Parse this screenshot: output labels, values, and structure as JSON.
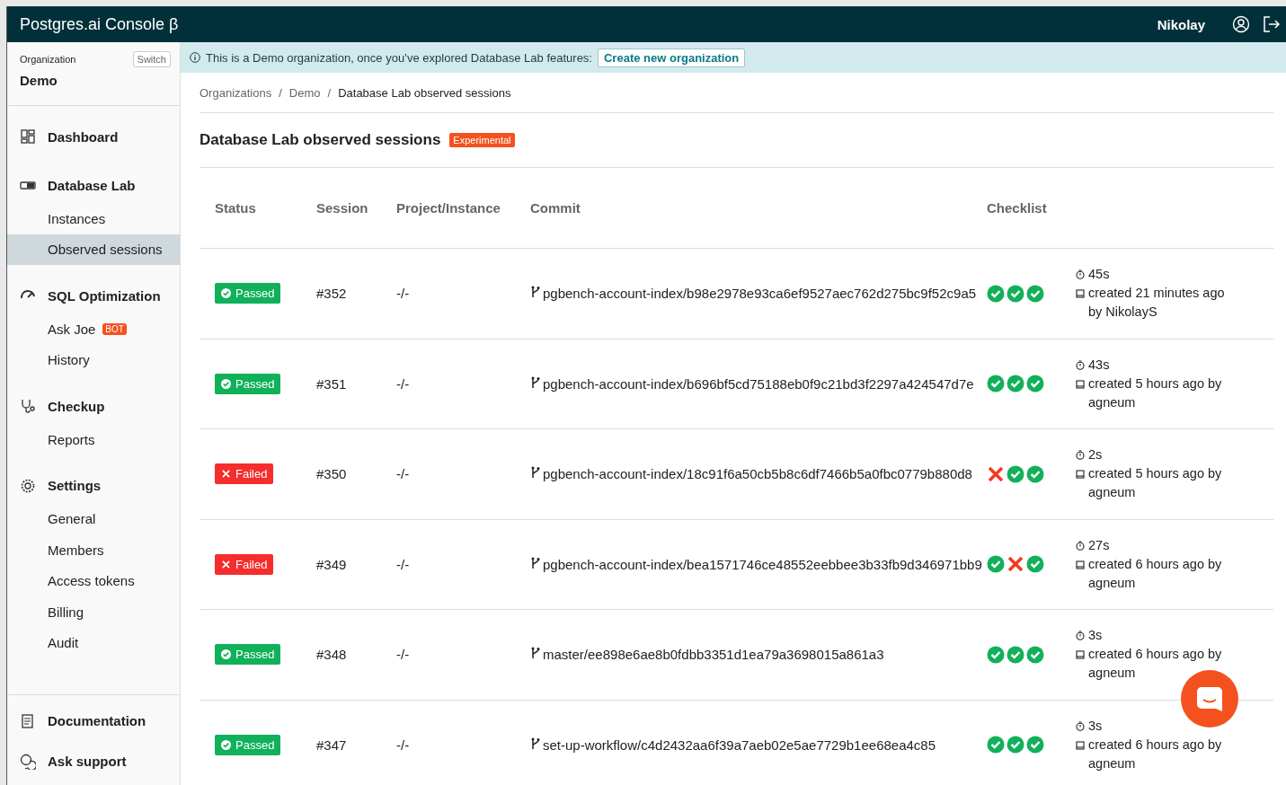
{
  "topbar": {
    "title": "Postgres.ai Console β",
    "user": "Nikolay"
  },
  "sidebar": {
    "org_label": "Organization",
    "switch_button": "Switch",
    "org_name": "Demo",
    "sections": [
      {
        "label": "Dashboard"
      },
      {
        "label": "Database Lab",
        "items": [
          {
            "label": "Instances",
            "selected": false
          },
          {
            "label": "Observed sessions",
            "selected": true
          }
        ]
      },
      {
        "label": "SQL Optimization",
        "items": [
          {
            "label": "Ask Joe",
            "badge": "BOT",
            "selected": false
          },
          {
            "label": "History",
            "selected": false
          }
        ]
      },
      {
        "label": "Checkup",
        "items": [
          {
            "label": "Reports",
            "selected": false
          }
        ]
      },
      {
        "label": "Settings",
        "items": [
          {
            "label": "General",
            "selected": false
          },
          {
            "label": "Members",
            "selected": false
          },
          {
            "label": "Access tokens",
            "selected": false
          },
          {
            "label": "Billing",
            "selected": false
          },
          {
            "label": "Audit",
            "selected": false
          }
        ]
      }
    ],
    "footer": [
      {
        "label": "Documentation"
      },
      {
        "label": "Ask support"
      }
    ]
  },
  "banner": {
    "text": "This is a Demo organization, once you’ve explored Database Lab features:",
    "button": "Create new organization"
  },
  "breadcrumbs": [
    {
      "kind": "link",
      "label": "Organizations"
    },
    {
      "kind": "separator",
      "label": "/"
    },
    {
      "kind": "link",
      "label": "Demo"
    },
    {
      "kind": "separator",
      "label": "/"
    },
    {
      "kind": "current",
      "label": "Database Lab observed sessions"
    }
  ],
  "page": {
    "title": "Database Lab observed sessions",
    "badge": "Experimental"
  },
  "table": {
    "columns": [
      "Status",
      "Session",
      "Project/Instance",
      "Commit",
      "Checklist"
    ],
    "rows": [
      {
        "status": {
          "kind": "passed",
          "label": "Passed"
        },
        "session": "#352",
        "project": "-/-",
        "commit": "pgbench-account-index/b98e2978e93ca6ef9527aec762d275bc9f52c9a5",
        "checks": [
          true,
          true,
          true
        ],
        "duration": "45s",
        "created": "created 21 minutes ago by NikolayS"
      },
      {
        "status": {
          "kind": "passed",
          "label": "Passed"
        },
        "session": "#351",
        "project": "-/-",
        "commit": "pgbench-account-index/b696bf5cd75188eb0f9c21bd3f2297a424547d7e",
        "checks": [
          true,
          true,
          true
        ],
        "duration": "43s",
        "created": "created 5 hours ago by agneum"
      },
      {
        "status": {
          "kind": "failed",
          "label": "Failed"
        },
        "session": "#350",
        "project": "-/-",
        "commit": "pgbench-account-index/18c91f6a50cb5b8c6df7466b5a0fbc0779b880d8",
        "checks": [
          false,
          true,
          true
        ],
        "duration": "2s",
        "created": "created 5 hours ago by agneum"
      },
      {
        "status": {
          "kind": "failed",
          "label": "Failed"
        },
        "session": "#349",
        "project": "-/-",
        "commit": "pgbench-account-index/bea1571746ce48552eebbee3b33fb9d346971bb9",
        "checks": [
          true,
          false,
          true
        ],
        "duration": "27s",
        "created": "created 6 hours ago by agneum"
      },
      {
        "status": {
          "kind": "passed",
          "label": "Passed"
        },
        "session": "#348",
        "project": "-/-",
        "commit": "master/ee898e6ae8b0fdbb3351d1ea79a3698015a861a3",
        "checks": [
          true,
          true,
          true
        ],
        "duration": "3s",
        "created": "created 6 hours ago by agneum"
      },
      {
        "status": {
          "kind": "passed",
          "label": "Passed"
        },
        "session": "#347",
        "project": "-/-",
        "commit": "set-up-workflow/c4d2432aa6f39a7aeb02e5ae7729b1ee68ea4c85",
        "checks": [
          true,
          true,
          true
        ],
        "duration": "3s",
        "created": "created 6 hours ago by agneum"
      }
    ]
  }
}
